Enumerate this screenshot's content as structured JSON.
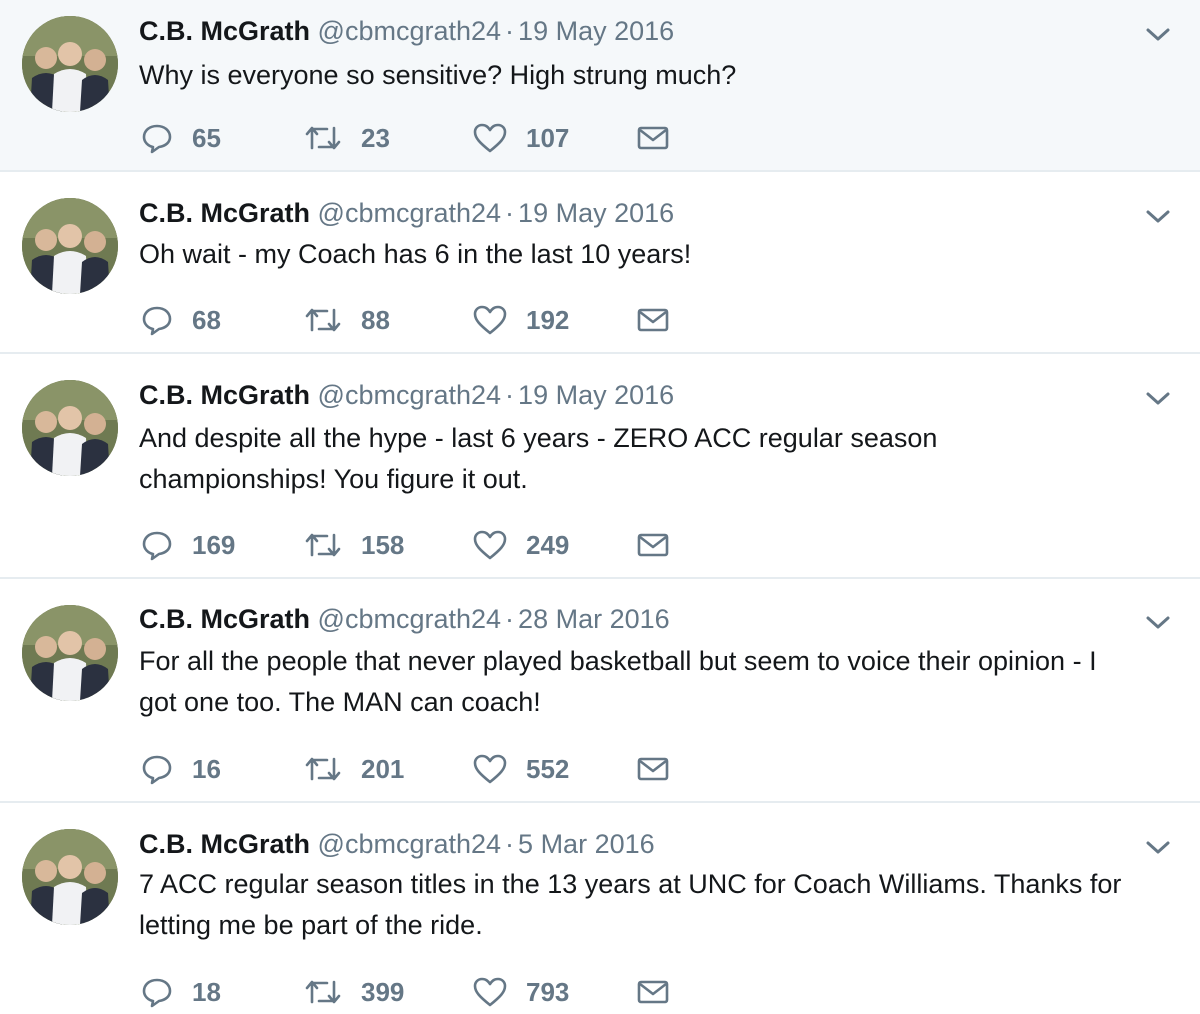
{
  "tweets": [
    {
      "name": "C.B. McGrath",
      "handle": "@cbmcgrath24",
      "separator": "·",
      "date": "19 May 2016",
      "text": "Why is everyone so sensitive?  High strung much?",
      "replies": "65",
      "retweets": "23",
      "likes": "107"
    },
    {
      "name": "C.B. McGrath",
      "handle": "@cbmcgrath24",
      "separator": "·",
      "date": "19 May 2016",
      "text": "Oh wait - my Coach has 6 in the last 10 years!",
      "replies": "68",
      "retweets": "88",
      "likes": "192"
    },
    {
      "name": "C.B. McGrath",
      "handle": "@cbmcgrath24",
      "separator": "·",
      "date": "19 May 2016",
      "text": "And despite all the hype - last 6 years - ZERO ACC regular season championships!  You figure it out.",
      "replies": "169",
      "retweets": "158",
      "likes": "249"
    },
    {
      "name": "C.B. McGrath",
      "handle": "@cbmcgrath24",
      "separator": "·",
      "date": "28 Mar 2016",
      "text": "For all the people that never played basketball but seem to voice their opinion - I got one too.  The MAN can coach!",
      "replies": "16",
      "retweets": "201",
      "likes": "552"
    },
    {
      "name": "C.B. McGrath",
      "handle": "@cbmcgrath24",
      "separator": "·",
      "date": "5 Mar 2016",
      "text": "7 ACC regular season titles in the 13 years at UNC for Coach Williams. Thanks for letting me be part of the ride.",
      "replies": "18",
      "retweets": "399",
      "likes": "793"
    }
  ],
  "icons": {
    "reply": "reply-icon",
    "retweet": "retweet-icon",
    "like": "heart-icon",
    "dm": "envelope-icon",
    "menu": "chevron-down-icon"
  },
  "colors": {
    "text": "#14171a",
    "muted": "#657786",
    "highlight_bg": "#f5f8fa",
    "divider": "#e6ecf0"
  }
}
